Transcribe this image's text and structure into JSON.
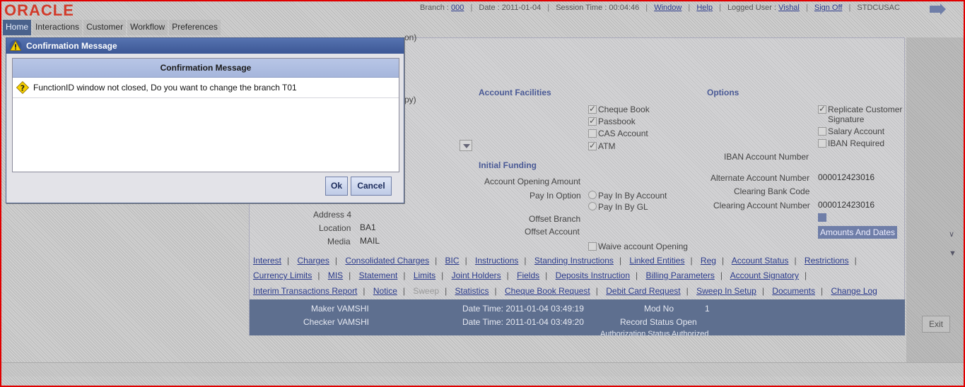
{
  "header": {
    "logo": "ORACLE",
    "branch_label": "Branch :",
    "branch_value": "000",
    "date_text": "Date : 2011-01-04",
    "session_time": "Session Time : 00:04:46",
    "window_link": "Window",
    "help_link": "Help",
    "logged_user_label": "Logged User :",
    "logged_user_value": "Vishal",
    "sign_off_link": "Sign Off",
    "screen_code": "STDCUSAC"
  },
  "nav": {
    "items": [
      "Home",
      "Interactions",
      "Customer",
      "Workflow",
      "Preferences"
    ],
    "active": "Home"
  },
  "background_form": {
    "partial_text_1": "on)",
    "partial_text_2": "py)",
    "account_facilities_header": "Account Facilities",
    "options_header": "Options",
    "facilities": [
      {
        "label": "Cheque Book",
        "checked": true
      },
      {
        "label": "Passbook",
        "checked": true
      },
      {
        "label": "CAS Account",
        "checked": false
      },
      {
        "label": "ATM",
        "checked": true
      }
    ],
    "options": [
      {
        "label": "Replicate Customer Signature",
        "checked": true
      },
      {
        "label": "Salary Account",
        "checked": false
      },
      {
        "label": "IBAN Required",
        "checked": false
      }
    ],
    "iban_account_number_label": "IBAN Account Number",
    "initial_funding_header": "Initial Funding",
    "account_opening_amount_label": "Account Opening Amount",
    "pay_in_option_label": "Pay In Option",
    "pay_in_by_account": "Pay In By Account",
    "pay_in_by_gl": "Pay In By GL",
    "offset_branch_label": "Offset Branch",
    "offset_account_label": "Offset Account",
    "waive_account_opening": "Waive account Opening",
    "alternate_account_number_label": "Alternate Account Number",
    "alternate_account_number_value": "000012423016",
    "clearing_bank_code_label": "Clearing Bank Code",
    "clearing_account_number_label": "Clearing Account Number",
    "clearing_account_number_value": "000012423016",
    "amounts_and_dates_button": "Amounts And Dates",
    "address4_label": "Address 4",
    "location_label": "Location",
    "location_value": "BA1",
    "media_label": "Media",
    "media_value": "MAIL"
  },
  "subsystem_links": {
    "row1": [
      "Interest",
      "Charges",
      "Consolidated Charges",
      "BIC",
      "Instructions",
      "Standing Instructions",
      "Linked Entities",
      "Reg",
      "Account Status",
      "Restrictions"
    ],
    "row2": [
      "Currency Limits",
      "MIS",
      "Statement",
      "Limits",
      "Joint Holders",
      "Fields",
      "Deposits Instruction",
      "Billing Parameters",
      "Account Signatory"
    ],
    "row3": [
      "Interim Transactions Report",
      "Notice",
      "Sweep",
      "Statistics",
      "Cheque Book Request",
      "Debit Card Request",
      "Sweep In Setup",
      "Documents",
      "Change Log"
    ],
    "disabled": [
      "Sweep"
    ]
  },
  "audit": {
    "maker": "Maker VAMSHI",
    "checker": "Checker VAMSHI",
    "maker_datetime": "Date Time: 2011-01-04 03:49:19",
    "checker_datetime": "Date Time: 2011-01-04 03:49:20",
    "mod_no_label": "Mod No",
    "mod_no_value": "1",
    "record_status": "Record Status Open",
    "authorization_status": "Authorization Status Authorized"
  },
  "exit_button": "Exit",
  "dialog": {
    "title": "Confirmation Message",
    "header": "Confirmation Message",
    "message": "FunctionID window not closed, Do you want to change the branch T01",
    "ok_label": "Ok",
    "cancel_label": "Cancel"
  },
  "colors": {
    "frame_border": "#e00000",
    "dialog_title_bar": "#3c5795",
    "dialog_header": "#a6b6dc",
    "audit_band": "#5e6f8f",
    "link": "#2a3a8c",
    "nav_active": "#4a628c"
  }
}
